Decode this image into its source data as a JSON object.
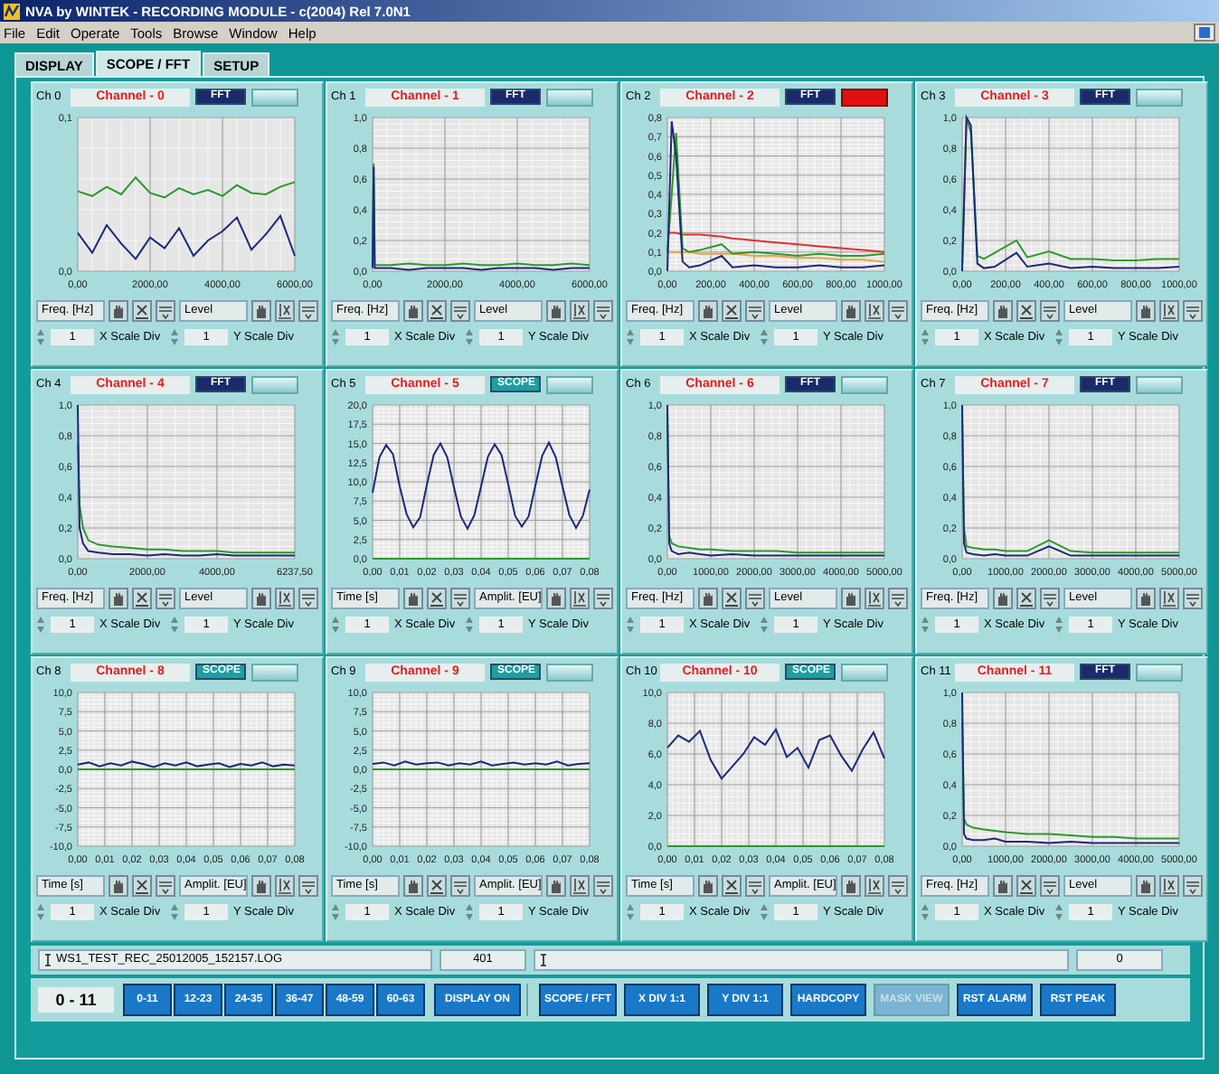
{
  "window": {
    "title": "NVA by WINTEK - RECORDING MODULE - c(2004) Rel 7.0N1"
  },
  "menu": [
    "File",
    "Edit",
    "Operate",
    "Tools",
    "Browse",
    "Window",
    "Help"
  ],
  "tabs": [
    {
      "label": "DISPLAY",
      "selected": false
    },
    {
      "label": "SCOPE / FFT",
      "selected": true
    },
    {
      "label": "SETUP",
      "selected": false
    }
  ],
  "channels": [
    {
      "label": "Ch 0",
      "name": "Channel - 0",
      "mode": "FFT",
      "alarm": false,
      "x_unit": "Freq. [Hz]",
      "y_unit": "Level",
      "x_div": "1",
      "x_div_label": "X Scale Div",
      "y_div": "1",
      "y_div_label": "Y Scale Div",
      "chart_data": {
        "type": "line",
        "grid": true,
        "x": [
          0,
          400,
          800,
          1200,
          1600,
          2000,
          2400,
          2800,
          3200,
          3600,
          4000,
          4400,
          4800,
          5200,
          5600,
          6000
        ],
        "xlim": [
          0,
          6000
        ],
        "ylim": [
          0,
          0.1
        ],
        "xticks": [
          {
            "value": 0,
            "label": "0,00"
          },
          {
            "value": 2000,
            "label": "2000,00"
          },
          {
            "value": 4000,
            "label": "4000,00"
          },
          {
            "value": 6000,
            "label": "6000,00"
          }
        ],
        "yticks": [
          {
            "value": 0,
            "label": "0,0"
          },
          {
            "value": 0.1,
            "label": "0,1"
          }
        ],
        "series": [
          {
            "color": "#2a9a2a",
            "values": [
              0.052,
              0.049,
              0.055,
              0.05,
              0.061,
              0.051,
              0.048,
              0.054,
              0.05,
              0.053,
              0.049,
              0.056,
              0.051,
              0.05,
              0.055,
              0.058
            ]
          },
          {
            "color": "#1a2a7a",
            "values": [
              0.025,
              0.012,
              0.03,
              0.018,
              0.008,
              0.022,
              0.015,
              0.028,
              0.01,
              0.02,
              0.026,
              0.035,
              0.014,
              0.024,
              0.036,
              0.01
            ]
          }
        ]
      }
    },
    {
      "label": "Ch 1",
      "name": "Channel - 1",
      "mode": "FFT",
      "alarm": false,
      "x_unit": "Freq. [Hz]",
      "y_unit": "Level",
      "x_div": "1",
      "x_div_label": "X Scale Div",
      "y_div": "1",
      "y_div_label": "Y Scale Div",
      "chart_data": {
        "type": "line",
        "grid": true,
        "x": [
          0,
          30,
          60,
          500,
          1000,
          1500,
          2000,
          2500,
          3000,
          3500,
          4000,
          4500,
          5000,
          5500,
          6000
        ],
        "xlim": [
          0,
          6000
        ],
        "ylim": [
          0,
          1
        ],
        "xticks": [
          {
            "value": 0,
            "label": "0,00"
          },
          {
            "value": 2000,
            "label": "2000,00"
          },
          {
            "value": 4000,
            "label": "4000,00"
          },
          {
            "value": 6000,
            "label": "6000,00"
          }
        ],
        "yticks": [
          {
            "value": 0,
            "label": "0,0"
          },
          {
            "value": 0.2,
            "label": "0,2"
          },
          {
            "value": 0.4,
            "label": "0,4"
          },
          {
            "value": 0.6,
            "label": "0,6"
          },
          {
            "value": 0.8,
            "label": "0,8"
          },
          {
            "value": 1,
            "label": "1,0"
          }
        ],
        "series": [
          {
            "color": "#2a9a2a",
            "values": [
              0.05,
              0.7,
              0.04,
              0.04,
              0.05,
              0.04,
              0.04,
              0.05,
              0.04,
              0.04,
              0.05,
              0.04,
              0.04,
              0.05,
              0.04
            ]
          },
          {
            "color": "#1a2a7a",
            "values": [
              0.02,
              0.68,
              0.02,
              0.02,
              0.01,
              0.02,
              0.02,
              0.02,
              0.01,
              0.02,
              0.02,
              0.02,
              0.01,
              0.02,
              0.02
            ]
          }
        ]
      }
    },
    {
      "label": "Ch 2",
      "name": "Channel - 2",
      "mode": "FFT",
      "alarm": true,
      "x_unit": "Freq. [Hz]",
      "y_unit": "Level",
      "x_div": "1",
      "x_div_label": "X Scale Div",
      "y_div": "1",
      "y_div_label": "Y Scale Div",
      "chart_data": {
        "type": "line",
        "grid": true,
        "x": [
          0,
          20,
          40,
          70,
          100,
          150,
          250,
          300,
          400,
          500,
          600,
          700,
          800,
          900,
          1000
        ],
        "xlim": [
          0,
          1000
        ],
        "ylim": [
          0,
          0.8
        ],
        "xticks": [
          {
            "value": 0,
            "label": "0,00"
          },
          {
            "value": 200,
            "label": "200,00"
          },
          {
            "value": 400,
            "label": "400,00"
          },
          {
            "value": 600,
            "label": "600,00"
          },
          {
            "value": 800,
            "label": "800,00"
          },
          {
            "value": 1000,
            "label": "1000,00"
          }
        ],
        "yticks": [
          {
            "value": 0,
            "label": "0,0"
          },
          {
            "value": 0.1,
            "label": "0,1"
          },
          {
            "value": 0.2,
            "label": "0,2"
          },
          {
            "value": 0.3,
            "label": "0,3"
          },
          {
            "value": 0.4,
            "label": "0,4"
          },
          {
            "value": 0.5,
            "label": "0,5"
          },
          {
            "value": 0.6,
            "label": "0,6"
          },
          {
            "value": 0.7,
            "label": "0,7"
          },
          {
            "value": 0.8,
            "label": "0,8"
          }
        ],
        "series": [
          {
            "color": "#e03030",
            "values": [
              0.2,
              0.2,
              0.2,
              0.19,
              0.19,
              0.19,
              0.18,
              0.17,
              0.16,
              0.15,
              0.14,
              0.13,
              0.12,
              0.11,
              0.1
            ]
          },
          {
            "color": "#f0a040",
            "values": [
              0.1,
              0.1,
              0.1,
              0.1,
              0.1,
              0.09,
              0.09,
              0.09,
              0.08,
              0.08,
              0.07,
              0.07,
              0.06,
              0.06,
              0.05
            ]
          },
          {
            "color": "#2a9a2a",
            "values": [
              0.1,
              0.4,
              0.72,
              0.12,
              0.1,
              0.11,
              0.14,
              0.09,
              0.1,
              0.09,
              0.08,
              0.09,
              0.08,
              0.08,
              0.09
            ]
          },
          {
            "color": "#1a2a7a",
            "values": [
              0,
              0.78,
              0.6,
              0.05,
              0.02,
              0.03,
              0.08,
              0.02,
              0.03,
              0.02,
              0.02,
              0.03,
              0.02,
              0.02,
              0.03
            ]
          }
        ]
      }
    },
    {
      "label": "Ch 3",
      "name": "Channel - 3",
      "mode": "FFT",
      "alarm": false,
      "x_unit": "Freq. [Hz]",
      "y_unit": "Level",
      "x_div": "1",
      "x_div_label": "X Scale Div",
      "y_div": "1",
      "y_div_label": "Y Scale Div",
      "chart_data": {
        "type": "line",
        "grid": true,
        "x": [
          0,
          20,
          40,
          70,
          100,
          150,
          250,
          300,
          400,
          500,
          600,
          700,
          800,
          900,
          1000
        ],
        "xlim": [
          0,
          1000
        ],
        "ylim": [
          0,
          1
        ],
        "xticks": [
          {
            "value": 0,
            "label": "0,00"
          },
          {
            "value": 200,
            "label": "200,00"
          },
          {
            "value": 400,
            "label": "400,00"
          },
          {
            "value": 600,
            "label": "600,00"
          },
          {
            "value": 800,
            "label": "800,00"
          },
          {
            "value": 1000,
            "label": "1000,00"
          }
        ],
        "yticks": [
          {
            "value": 0,
            "label": "0,0"
          },
          {
            "value": 0.2,
            "label": "0,2"
          },
          {
            "value": 0.4,
            "label": "0,4"
          },
          {
            "value": 0.6,
            "label": "0,6"
          },
          {
            "value": 0.8,
            "label": "0,8"
          },
          {
            "value": 1,
            "label": "1,0"
          }
        ],
        "series": [
          {
            "color": "#2a9a2a",
            "values": [
              0.05,
              1,
              0.9,
              0.1,
              0.08,
              0.12,
              0.2,
              0.09,
              0.13,
              0.08,
              0.08,
              0.07,
              0.07,
              0.08,
              0.08
            ]
          },
          {
            "color": "#1a2a7a",
            "values": [
              0,
              1,
              0.95,
              0.05,
              0.02,
              0.03,
              0.12,
              0.03,
              0.05,
              0.02,
              0.03,
              0.02,
              0.02,
              0.02,
              0.03
            ]
          }
        ]
      }
    },
    {
      "label": "Ch 4",
      "name": "Channel - 4",
      "mode": "FFT",
      "alarm": false,
      "x_unit": "Freq. [Hz]",
      "y_unit": "Level",
      "x_div": "1",
      "x_div_label": "X Scale Div",
      "y_div": "1",
      "y_div_label": "Y Scale Div",
      "chart_data": {
        "type": "line",
        "grid": true,
        "x": [
          0,
          50,
          150,
          300,
          600,
          1000,
          1500,
          2000,
          2500,
          3000,
          3500,
          4000,
          4500,
          5000,
          5500,
          6237.5
        ],
        "xlim": [
          0,
          6237.5
        ],
        "ylim": [
          0,
          1
        ],
        "xticks": [
          {
            "value": 0,
            "label": "0,00"
          },
          {
            "value": 2000,
            "label": "2000,00"
          },
          {
            "value": 4000,
            "label": "4000,00"
          },
          {
            "value": 6237.5,
            "label": "6237,50"
          }
        ],
        "yticks": [
          {
            "value": 0,
            "label": "0,0"
          },
          {
            "value": 0.2,
            "label": "0,2"
          },
          {
            "value": 0.4,
            "label": "0,4"
          },
          {
            "value": 0.6,
            "label": "0,6"
          },
          {
            "value": 0.8,
            "label": "0,8"
          },
          {
            "value": 1,
            "label": "1,0"
          }
        ],
        "series": [
          {
            "color": "#2a9a2a",
            "values": [
              0.75,
              0.35,
              0.2,
              0.12,
              0.09,
              0.08,
              0.07,
              0.06,
              0.06,
              0.05,
              0.05,
              0.05,
              0.04,
              0.04,
              0.04,
              0.04
            ]
          },
          {
            "color": "#1a2a7a",
            "values": [
              1,
              0.2,
              0.1,
              0.05,
              0.04,
              0.03,
              0.03,
              0.02,
              0.03,
              0.02,
              0.02,
              0.03,
              0.02,
              0.02,
              0.02,
              0.02
            ]
          }
        ]
      }
    },
    {
      "label": "Ch 5",
      "name": "Channel - 5",
      "mode": "SCOPE",
      "alarm": false,
      "x_unit": "Time [s]",
      "y_unit": "Amplit. [EU]",
      "x_div": "1",
      "x_div_label": "X Scale Div",
      "y_div": "1",
      "y_div_label": "Y Scale Div",
      "chart_data": {
        "type": "line",
        "grid": true,
        "x": [
          0,
          0.0025,
          0.005,
          0.0075,
          0.01,
          0.0125,
          0.015,
          0.0175,
          0.02,
          0.0225,
          0.025,
          0.0275,
          0.03,
          0.0325,
          0.035,
          0.0375,
          0.04,
          0.0425,
          0.045,
          0.0475,
          0.05,
          0.0525,
          0.055,
          0.0575,
          0.06,
          0.0625,
          0.065,
          0.0675,
          0.07,
          0.0725,
          0.075,
          0.0775,
          0.08
        ],
        "xlim": [
          0,
          0.08
        ],
        "ylim": [
          0,
          20
        ],
        "xticks": [
          {
            "value": 0,
            "label": "0,00"
          },
          {
            "value": 0.01,
            "label": "0,01"
          },
          {
            "value": 0.02,
            "label": "0,02"
          },
          {
            "value": 0.03,
            "label": "0,03"
          },
          {
            "value": 0.04,
            "label": "0,04"
          },
          {
            "value": 0.05,
            "label": "0,05"
          },
          {
            "value": 0.06,
            "label": "0,06"
          },
          {
            "value": 0.07,
            "label": "0,07"
          },
          {
            "value": 0.08,
            "label": "0,08"
          }
        ],
        "yticks": [
          {
            "value": 0,
            "label": "0,0"
          },
          {
            "value": 2.5,
            "label": "2,5"
          },
          {
            "value": 5,
            "label": "5,0"
          },
          {
            "value": 7.5,
            "label": "7,5"
          },
          {
            "value": 10,
            "label": "10,0"
          },
          {
            "value": 12.5,
            "label": "12,5"
          },
          {
            "value": 15,
            "label": "15,0"
          },
          {
            "value": 17.5,
            "label": "17,5"
          },
          {
            "value": 20,
            "label": "20,0"
          }
        ],
        "series": [
          {
            "color": "#2a9a2a",
            "values": [
              0,
              0,
              0,
              0,
              0,
              0,
              0,
              0,
              0,
              0,
              0,
              0,
              0,
              0,
              0,
              0,
              0,
              0,
              0,
              0,
              0,
              0,
              0,
              0,
              0,
              0,
              0,
              0,
              0,
              0,
              0,
              0,
              0
            ]
          },
          {
            "color": "#1a2a7a",
            "values": [
              8.6,
              13.2,
              14.8,
              13.6,
              9.4,
              5.8,
              4.1,
              5.4,
              9.6,
              13.5,
              15,
              13.2,
              9.3,
              5.5,
              3.9,
              5.7,
              9.4,
              13.3,
              14.9,
              13.5,
              9.7,
              5.6,
              4.2,
              5.5,
              9.5,
              13.4,
              15.1,
              13.2,
              9.4,
              5.7,
              4,
              5.6,
              9
            ]
          }
        ]
      }
    },
    {
      "label": "Ch 6",
      "name": "Channel - 6",
      "mode": "FFT",
      "alarm": false,
      "x_unit": "Freq. [Hz]",
      "y_unit": "Level",
      "x_div": "1",
      "x_div_label": "X Scale Div",
      "y_div": "1",
      "y_div_label": "Y Scale Div",
      "chart_data": {
        "type": "line",
        "grid": true,
        "x": [
          0,
          40,
          100,
          250,
          500,
          750,
          1000,
          1500,
          2000,
          2500,
          3000,
          3500,
          4000,
          4500,
          5000
        ],
        "xlim": [
          0,
          5000
        ],
        "ylim": [
          0,
          1
        ],
        "xticks": [
          {
            "value": 0,
            "label": "0,00"
          },
          {
            "value": 1000,
            "label": "1000,00"
          },
          {
            "value": 2000,
            "label": "2000,00"
          },
          {
            "value": 3000,
            "label": "3000,00"
          },
          {
            "value": 4000,
            "label": "4000,00"
          },
          {
            "value": 5000,
            "label": "5000,00"
          }
        ],
        "yticks": [
          {
            "value": 0,
            "label": "0,0"
          },
          {
            "value": 0.2,
            "label": "0,2"
          },
          {
            "value": 0.4,
            "label": "0,4"
          },
          {
            "value": 0.6,
            "label": "0,6"
          },
          {
            "value": 0.8,
            "label": "0,8"
          },
          {
            "value": 1,
            "label": "1,0"
          }
        ],
        "series": [
          {
            "color": "#2a9a2a",
            "values": [
              0.95,
              0.15,
              0.1,
              0.08,
              0.07,
              0.06,
              0.06,
              0.05,
              0.05,
              0.05,
              0.04,
              0.04,
              0.04,
              0.04,
              0.04
            ]
          },
          {
            "color": "#1a2a7a",
            "values": [
              1,
              0.1,
              0.05,
              0.03,
              0.04,
              0.03,
              0.02,
              0.03,
              0.02,
              0.02,
              0.02,
              0.02,
              0.02,
              0.02,
              0.02
            ]
          }
        ]
      }
    },
    {
      "label": "Ch 7",
      "name": "Channel - 7",
      "mode": "FFT",
      "alarm": false,
      "x_unit": "Freq. [Hz]",
      "y_unit": "Level",
      "x_div": "1",
      "x_div_label": "X Scale Div",
      "y_div": "1",
      "y_div_label": "Y Scale Div",
      "chart_data": {
        "type": "line",
        "grid": true,
        "x": [
          0,
          40,
          100,
          250,
          500,
          750,
          1000,
          1500,
          2000,
          2500,
          3000,
          3500,
          4000,
          4500,
          5000
        ],
        "xlim": [
          0,
          5000
        ],
        "ylim": [
          0,
          1
        ],
        "xticks": [
          {
            "value": 0,
            "label": "0,00"
          },
          {
            "value": 1000,
            "label": "1000,00"
          },
          {
            "value": 2000,
            "label": "2000,00"
          },
          {
            "value": 3000,
            "label": "3000,00"
          },
          {
            "value": 4000,
            "label": "4000,00"
          },
          {
            "value": 5000,
            "label": "5000,00"
          }
        ],
        "yticks": [
          {
            "value": 0,
            "label": "0,0"
          },
          {
            "value": 0.2,
            "label": "0,2"
          },
          {
            "value": 0.4,
            "label": "0,4"
          },
          {
            "value": 0.6,
            "label": "0,6"
          },
          {
            "value": 0.8,
            "label": "0,8"
          },
          {
            "value": 1,
            "label": "1,0"
          }
        ],
        "series": [
          {
            "color": "#2a9a2a",
            "values": [
              0.9,
              0.2,
              0.08,
              0.07,
              0.06,
              0.06,
              0.05,
              0.05,
              0.12,
              0.05,
              0.04,
              0.04,
              0.04,
              0.04,
              0.04
            ]
          },
          {
            "color": "#1a2a7a",
            "values": [
              1,
              0.1,
              0.04,
              0.03,
              0.02,
              0.03,
              0.02,
              0.02,
              0.08,
              0.02,
              0.02,
              0.02,
              0.02,
              0.02,
              0.02
            ]
          }
        ]
      }
    },
    {
      "label": "Ch 8",
      "name": "Channel - 8",
      "mode": "SCOPE",
      "alarm": false,
      "x_unit": "Time [s]",
      "y_unit": "Amplit. [EU]",
      "x_div": "1",
      "x_div_label": "X Scale Div",
      "y_div": "1",
      "y_div_label": "Y Scale Div",
      "chart_data": {
        "type": "line",
        "grid": true,
        "x": [
          0,
          0.004,
          0.008,
          0.012,
          0.016,
          0.02,
          0.024,
          0.028,
          0.032,
          0.036,
          0.04,
          0.044,
          0.048,
          0.052,
          0.056,
          0.06,
          0.064,
          0.068,
          0.072,
          0.076,
          0.08
        ],
        "xlim": [
          0,
          0.08
        ],
        "ylim": [
          -10,
          10
        ],
        "xticks": [
          {
            "value": 0,
            "label": "0,00"
          },
          {
            "value": 0.01,
            "label": "0,01"
          },
          {
            "value": 0.02,
            "label": "0,02"
          },
          {
            "value": 0.03,
            "label": "0,03"
          },
          {
            "value": 0.04,
            "label": "0,04"
          },
          {
            "value": 0.05,
            "label": "0,05"
          },
          {
            "value": 0.06,
            "label": "0,06"
          },
          {
            "value": 0.07,
            "label": "0,07"
          },
          {
            "value": 0.08,
            "label": "0,08"
          }
        ],
        "yticks": [
          {
            "value": -10,
            "label": "-10,0"
          },
          {
            "value": -7.5,
            "label": "-7,5"
          },
          {
            "value": -5,
            "label": "-5,0"
          },
          {
            "value": -2.5,
            "label": "-2,5"
          },
          {
            "value": 0,
            "label": "0,0"
          },
          {
            "value": 2.5,
            "label": "2,5"
          },
          {
            "value": 5,
            "label": "5,0"
          },
          {
            "value": 7.5,
            "label": "7,5"
          },
          {
            "value": 10,
            "label": "10,0"
          }
        ],
        "series": [
          {
            "color": "#2a9a2a",
            "values": [
              0,
              0,
              0,
              0,
              0,
              0,
              0,
              0,
              0,
              0,
              0,
              0,
              0,
              0,
              0,
              0,
              0,
              0,
              0,
              0,
              0
            ]
          },
          {
            "color": "#1a2a7a",
            "values": [
              0.6,
              0.9,
              0.4,
              0.8,
              0.5,
              1,
              0.7,
              0.3,
              0.8,
              0.5,
              0.9,
              0.4,
              0.6,
              0.8,
              0.3,
              0.7,
              0.5,
              0.9,
              0.4,
              0.6,
              0.5
            ]
          }
        ]
      }
    },
    {
      "label": "Ch 9",
      "name": "Channel - 9",
      "mode": "SCOPE",
      "alarm": false,
      "x_unit": "Time [s]",
      "y_unit": "Amplit. [EU]",
      "x_div": "1",
      "x_div_label": "X Scale Div",
      "y_div": "1",
      "y_div_label": "Y Scale Div",
      "chart_data": {
        "type": "line",
        "grid": true,
        "x": [
          0,
          0.004,
          0.008,
          0.012,
          0.016,
          0.02,
          0.024,
          0.028,
          0.032,
          0.036,
          0.04,
          0.044,
          0.048,
          0.052,
          0.056,
          0.06,
          0.064,
          0.068,
          0.072,
          0.076,
          0.08
        ],
        "xlim": [
          0,
          0.08
        ],
        "ylim": [
          -10,
          10
        ],
        "xticks": [
          {
            "value": 0,
            "label": "0,00"
          },
          {
            "value": 0.01,
            "label": "0,01"
          },
          {
            "value": 0.02,
            "label": "0,02"
          },
          {
            "value": 0.03,
            "label": "0,03"
          },
          {
            "value": 0.04,
            "label": "0,04"
          },
          {
            "value": 0.05,
            "label": "0,05"
          },
          {
            "value": 0.06,
            "label": "0,06"
          },
          {
            "value": 0.07,
            "label": "0,07"
          },
          {
            "value": 0.08,
            "label": "0,08"
          }
        ],
        "yticks": [
          {
            "value": -10,
            "label": "-10,0"
          },
          {
            "value": -7.5,
            "label": "-7,5"
          },
          {
            "value": -5,
            "label": "-5,0"
          },
          {
            "value": -2.5,
            "label": "-2,5"
          },
          {
            "value": 0,
            "label": "0,0"
          },
          {
            "value": 2.5,
            "label": "2,5"
          },
          {
            "value": 5,
            "label": "5,0"
          },
          {
            "value": 7.5,
            "label": "7,5"
          },
          {
            "value": 10,
            "label": "10,0"
          }
        ],
        "series": [
          {
            "color": "#2a9a2a",
            "values": [
              0,
              0,
              0,
              0,
              0,
              0,
              0,
              0,
              0,
              0,
              0,
              0,
              0,
              0,
              0,
              0,
              0,
              0,
              0,
              0,
              0
            ]
          },
          {
            "color": "#1a2a7a",
            "values": [
              0.7,
              0.9,
              0.5,
              1,
              0.6,
              0.8,
              0.9,
              0.5,
              0.8,
              0.6,
              1,
              0.5,
              0.7,
              0.9,
              0.6,
              0.8,
              0.6,
              1,
              0.5,
              0.7,
              0.8
            ]
          }
        ]
      }
    },
    {
      "label": "Ch 10",
      "name": "Channel - 10",
      "mode": "SCOPE",
      "alarm": false,
      "x_unit": "Time [s]",
      "y_unit": "Amplit. [EU]",
      "x_div": "1",
      "x_div_label": "X Scale Div",
      "y_div": "1",
      "y_div_label": "Y Scale Div",
      "chart_data": {
        "type": "line",
        "grid": true,
        "x": [
          0,
          0.004,
          0.008,
          0.012,
          0.016,
          0.02,
          0.024,
          0.028,
          0.032,
          0.036,
          0.04,
          0.044,
          0.048,
          0.052,
          0.056,
          0.06,
          0.064,
          0.068,
          0.072,
          0.076,
          0.08
        ],
        "xlim": [
          0,
          0.08
        ],
        "ylim": [
          0,
          10
        ],
        "xticks": [
          {
            "value": 0,
            "label": "0,00"
          },
          {
            "value": 0.01,
            "label": "0,01"
          },
          {
            "value": 0.02,
            "label": "0,02"
          },
          {
            "value": 0.03,
            "label": "0,03"
          },
          {
            "value": 0.04,
            "label": "0,04"
          },
          {
            "value": 0.05,
            "label": "0,05"
          },
          {
            "value": 0.06,
            "label": "0,06"
          },
          {
            "value": 0.07,
            "label": "0,07"
          },
          {
            "value": 0.08,
            "label": "0,08"
          }
        ],
        "yticks": [
          {
            "value": 0,
            "label": "0,0"
          },
          {
            "value": 2,
            "label": "2,0"
          },
          {
            "value": 4,
            "label": "4,0"
          },
          {
            "value": 6,
            "label": "6,0"
          },
          {
            "value": 8,
            "label": "8,0"
          },
          {
            "value": 10,
            "label": "10,0"
          }
        ],
        "series": [
          {
            "color": "#2a9a2a",
            "values": [
              0,
              0,
              0,
              0,
              0,
              0,
              0,
              0,
              0,
              0,
              0,
              0,
              0,
              0,
              0,
              0,
              0,
              0,
              0,
              0,
              0
            ]
          },
          {
            "color": "#1a2a7a",
            "values": [
              6.4,
              7.2,
              6.8,
              7.5,
              5.6,
              4.4,
              5.2,
              6,
              7.1,
              6.6,
              7.6,
              5.8,
              6.4,
              5.1,
              6.9,
              7.2,
              5.9,
              4.9,
              6.3,
              7.4,
              5.7
            ]
          }
        ]
      }
    },
    {
      "label": "Ch 11",
      "name": "Channel - 11",
      "mode": "FFT",
      "alarm": false,
      "x_unit": "Freq. [Hz]",
      "y_unit": "Level",
      "x_div": "1",
      "x_div_label": "X Scale Div",
      "y_div": "1",
      "y_div_label": "Y Scale Div",
      "chart_data": {
        "type": "line",
        "grid": true,
        "x": [
          0,
          40,
          100,
          250,
          500,
          750,
          1000,
          1500,
          2000,
          2500,
          3000,
          3500,
          4000,
          4500,
          5000
        ],
        "xlim": [
          0,
          5000
        ],
        "ylim": [
          0,
          1
        ],
        "xticks": [
          {
            "value": 0,
            "label": "0,00"
          },
          {
            "value": 1000,
            "label": "1000,00"
          },
          {
            "value": 2000,
            "label": "2000,00"
          },
          {
            "value": 3000,
            "label": "3000,00"
          },
          {
            "value": 4000,
            "label": "4000,00"
          },
          {
            "value": 5000,
            "label": "5000,00"
          }
        ],
        "yticks": [
          {
            "value": 0,
            "label": "0,0"
          },
          {
            "value": 0.2,
            "label": "0,2"
          },
          {
            "value": 0.4,
            "label": "0,4"
          },
          {
            "value": 0.6,
            "label": "0,6"
          },
          {
            "value": 0.8,
            "label": "0,8"
          },
          {
            "value": 1,
            "label": "1,0"
          }
        ],
        "series": [
          {
            "color": "#2a9a2a",
            "values": [
              0.82,
              0.18,
              0.14,
              0.12,
              0.11,
              0.1,
              0.09,
              0.08,
              0.08,
              0.07,
              0.06,
              0.06,
              0.05,
              0.05,
              0.05
            ]
          },
          {
            "color": "#1a2a7a",
            "values": [
              1,
              0.08,
              0.05,
              0.04,
              0.04,
              0.05,
              0.03,
              0.03,
              0.02,
              0.03,
              0.02,
              0.02,
              0.02,
              0.02,
              0.02
            ]
          }
        ]
      }
    }
  ],
  "status": {
    "file": "WS1_TEST_REC_25012005_152157.LOG",
    "file_count": "401",
    "message_count": "0"
  },
  "bank_display": "0 - 11",
  "bank_buttons": [
    {
      "label": "0-11",
      "disabled": false
    },
    {
      "label": "12-23",
      "disabled": false
    },
    {
      "label": "24-35",
      "disabled": false
    },
    {
      "label": "36-47",
      "disabled": false
    },
    {
      "label": "48-59",
      "disabled": false
    },
    {
      "label": "60-63",
      "disabled": false
    }
  ],
  "display_button": {
    "label": "DISPLAY ON",
    "disabled": false
  },
  "action_buttons": [
    {
      "label": "SCOPE / FFT",
      "disabled": false
    },
    {
      "label": "X DIV 1:1",
      "disabled": false
    },
    {
      "label": "Y DIV 1:1",
      "disabled": false
    },
    {
      "label": "HARDCOPY",
      "disabled": false
    },
    {
      "label": "MASK VIEW",
      "disabled": true
    },
    {
      "label": "RST ALARM",
      "disabled": false
    },
    {
      "label": "RST PEAK",
      "disabled": false
    }
  ]
}
